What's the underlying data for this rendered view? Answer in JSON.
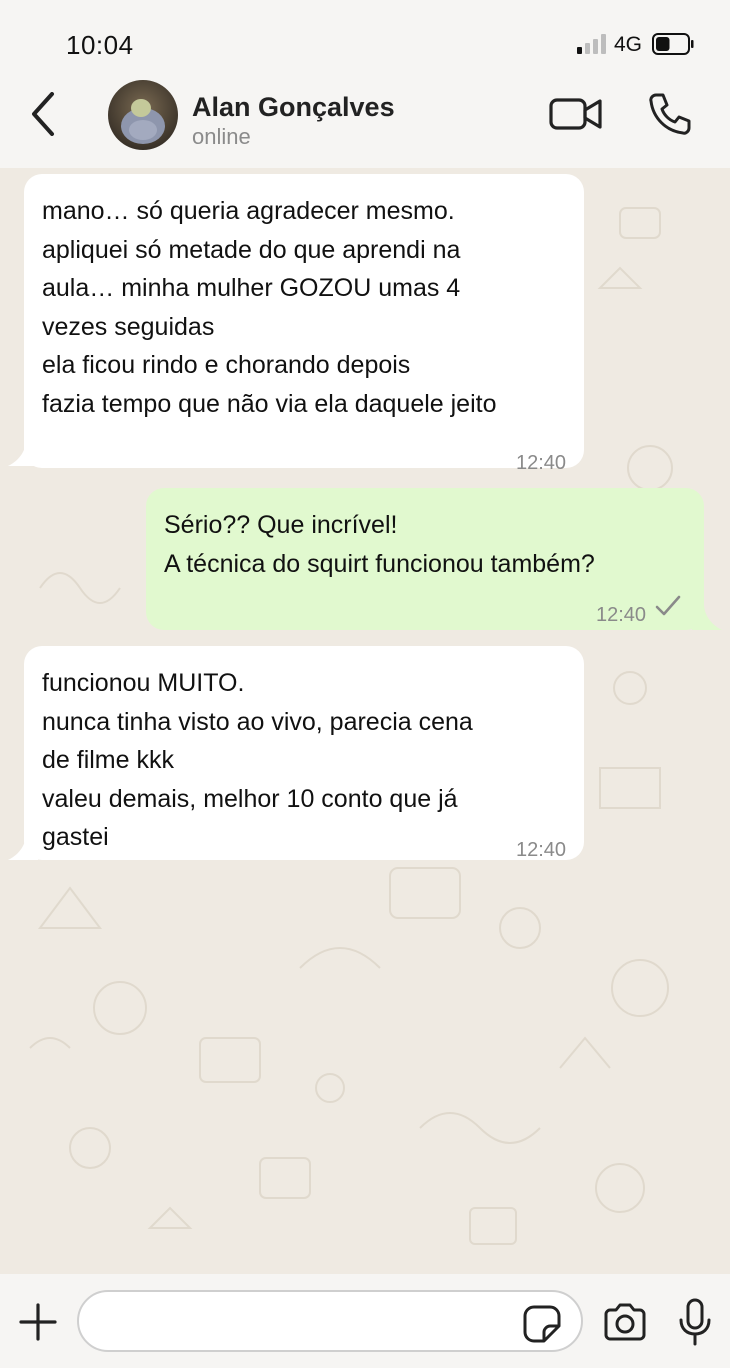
{
  "status_bar": {
    "time": "10:04",
    "network": "4G",
    "signal_bars_active": 1,
    "signal_bars_total": 4,
    "battery_level": 0.45
  },
  "header": {
    "contact_name": "Alan Gonçalves",
    "contact_status": "online",
    "back_icon": "chevron-left-icon",
    "video_icon": "video-camera-icon",
    "call_icon": "phone-icon"
  },
  "messages": [
    {
      "direction": "in",
      "lines": [
        "mano… só queria agradecer mesmo.",
        "apliquei só metade do que aprendi na",
        "aula… minha mulher GOZOU umas 4",
        "vezes seguidas",
        "ela ficou rindo e chorando depois",
        "fazia tempo que não via ela daquele jeito"
      ],
      "time": "12:40"
    },
    {
      "direction": "out",
      "lines": [
        "Sério?? Que incrível!",
        "A técnica do squirt funcionou também?"
      ],
      "time": "12:40",
      "status_icon": "single-check-icon"
    },
    {
      "direction": "in",
      "lines": [
        "funcionou MUITO.",
        "nunca tinha visto ao vivo, parecia cena",
        "de filme kkk",
        "valeu demais, melhor 10 conto que já",
        "gastei"
      ],
      "time": "12:40"
    }
  ],
  "composer": {
    "input_value": "",
    "input_placeholder": "",
    "plus_icon": "plus-icon",
    "sticker_icon": "sticker-icon",
    "camera_icon": "camera-icon",
    "mic_icon": "microphone-icon"
  },
  "colors": {
    "incoming_bubble": "#ffffff",
    "outgoing_bubble": "#e1f9cf",
    "chat_background": "#efeae2",
    "bar_background": "#f6f5f3",
    "timestamp": "#8a8a8a"
  }
}
